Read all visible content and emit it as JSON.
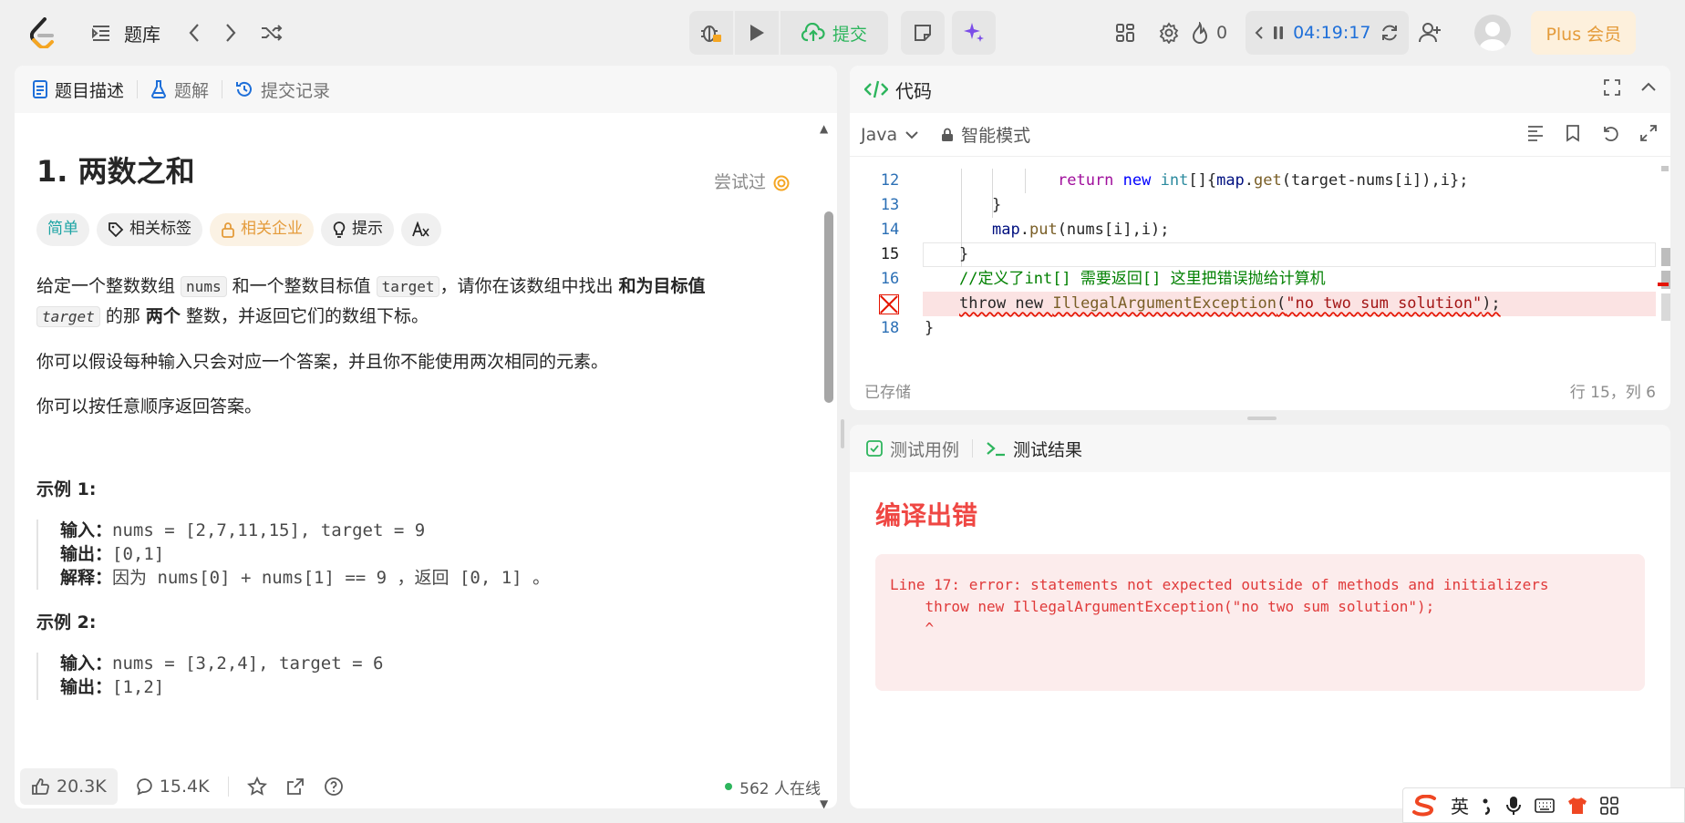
{
  "topbar": {
    "title": "题库",
    "submit_label": "提交",
    "streak_count": "0",
    "timer": "04:19:17",
    "plus_label": "Plus 会员"
  },
  "problem_tabs": [
    {
      "label": "题目描述"
    },
    {
      "label": "题解"
    },
    {
      "label": "提交记录"
    }
  ],
  "problem": {
    "title": "1. 两数之和",
    "status": "尝试过",
    "chips": {
      "difficulty": "简单",
      "tags": "相关标签",
      "companies": "相关企业",
      "hints": "提示"
    },
    "desc": {
      "t1": "给定一个整数数组 ",
      "c1": "nums",
      "t2": " 和一个整数目标值 ",
      "c2": "target",
      "t3": "，请你在该数组中找出 ",
      "b1": "和为目标值",
      "c3": "target",
      "t4": " 的那 ",
      "b2": "两个",
      "t5": " 整数，并返回它们的数组下标。"
    },
    "p2": "你可以假设每种输入只会对应一个答案，并且你不能使用两次相同的元素。",
    "p3": "你可以按任意顺序返回答案。",
    "example1": {
      "title": "示例 1:",
      "input_label": "输入：",
      "input": "nums = [2,7,11,15], target = 9",
      "output_label": "输出：",
      "output": "[0,1]",
      "explain_label": "解释：",
      "explain": "因为 nums[0] + nums[1] == 9 ，返回 [0, 1] 。"
    },
    "example2": {
      "title": "示例 2:",
      "input_label": "输入：",
      "input": "nums = [3,2,4], target = 6",
      "output_label": "输出：",
      "output": "[1,2]"
    }
  },
  "footer": {
    "likes": "20.3K",
    "comments": "15.4K",
    "online": "562 人在线"
  },
  "code_panel": {
    "title": "代码",
    "language": "Java",
    "mode": "智能模式",
    "saved": "已存储",
    "cursor": "行 15，列 6",
    "lines": [
      {
        "n": "12",
        "segments": [
          [
            "return",
            "kw"
          ],
          [
            " ",
            ""
          ],
          [
            "new",
            "k"
          ],
          [
            " ",
            ""
          ],
          [
            "int",
            "t"
          ],
          [
            "[]{",
            ""
          ],
          [
            "map",
            "v"
          ],
          [
            ".",
            ""
          ],
          [
            "get",
            "f"
          ],
          [
            "(target-nums[i]),i};",
            ""
          ]
        ]
      },
      {
        "n": "13",
        "segments": [
          [
            "}",
            ""
          ]
        ]
      },
      {
        "n": "14",
        "segments": [
          [
            "map",
            "v"
          ],
          [
            ".",
            ""
          ],
          [
            "put",
            "f"
          ],
          [
            "(nums[i],i);",
            ""
          ]
        ]
      },
      {
        "n": "15",
        "segments": [
          [
            "}",
            ""
          ]
        ]
      },
      {
        "n": "16",
        "segments": [
          [
            "//定义了",
            "cm"
          ],
          [
            "int[]",
            "cm"
          ],
          [
            " 需要返回",
            "cm"
          ],
          [
            "[]",
            "cm"
          ],
          [
            " 这里把错误抛给计算机",
            "cm"
          ]
        ]
      },
      {
        "n": "",
        "segments": [
          [
            "throw new ",
            ""
          ],
          [
            "IllegalArgumentException",
            "f"
          ],
          [
            "(",
            ""
          ],
          [
            "\"no two sum solution\"",
            "s"
          ],
          [
            ");",
            ""
          ]
        ]
      },
      {
        "n": "18",
        "segments": [
          [
            "}",
            ""
          ]
        ]
      }
    ]
  },
  "result_panel": {
    "tab_cases": "测试用例",
    "tab_result": "测试结果",
    "status": "编译出错",
    "message": "Line 17: error: statements not expected outside of methods and initializers\n    throw new IllegalArgumentException(\"no two sum solution\");\n    ^"
  },
  "ime": {
    "lang": "英"
  },
  "colors": {
    "accent_green": "#2db55d",
    "timer_blue": "#1e6fd9",
    "error_red": "#ef4743",
    "plus_orange": "#e49b3a"
  }
}
